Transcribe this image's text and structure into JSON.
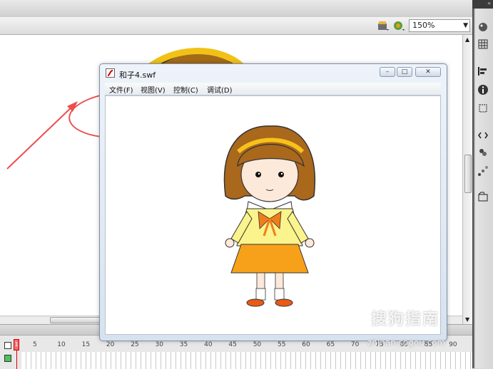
{
  "toolbar": {
    "zoom_value": "150%"
  },
  "swf_window": {
    "title": "和子4.swf",
    "menu": [
      "文件(F)",
      "视图(V)",
      "控制(C)",
      "调试(D)"
    ],
    "minimize_glyph": "–",
    "maximize_glyph": "□",
    "close_glyph": "✕"
  },
  "timeline": {
    "current_frame": "1",
    "ruler": [
      "5",
      "10",
      "15",
      "20",
      "25",
      "30",
      "35",
      "40",
      "45",
      "50",
      "55",
      "60",
      "65",
      "70",
      "75",
      "80",
      "85",
      "90"
    ]
  },
  "watermark": {
    "brand": "搜狗指南",
    "url": "zhinan.sogou.com"
  },
  "annotation": {
    "color": "#ec4f4f"
  }
}
